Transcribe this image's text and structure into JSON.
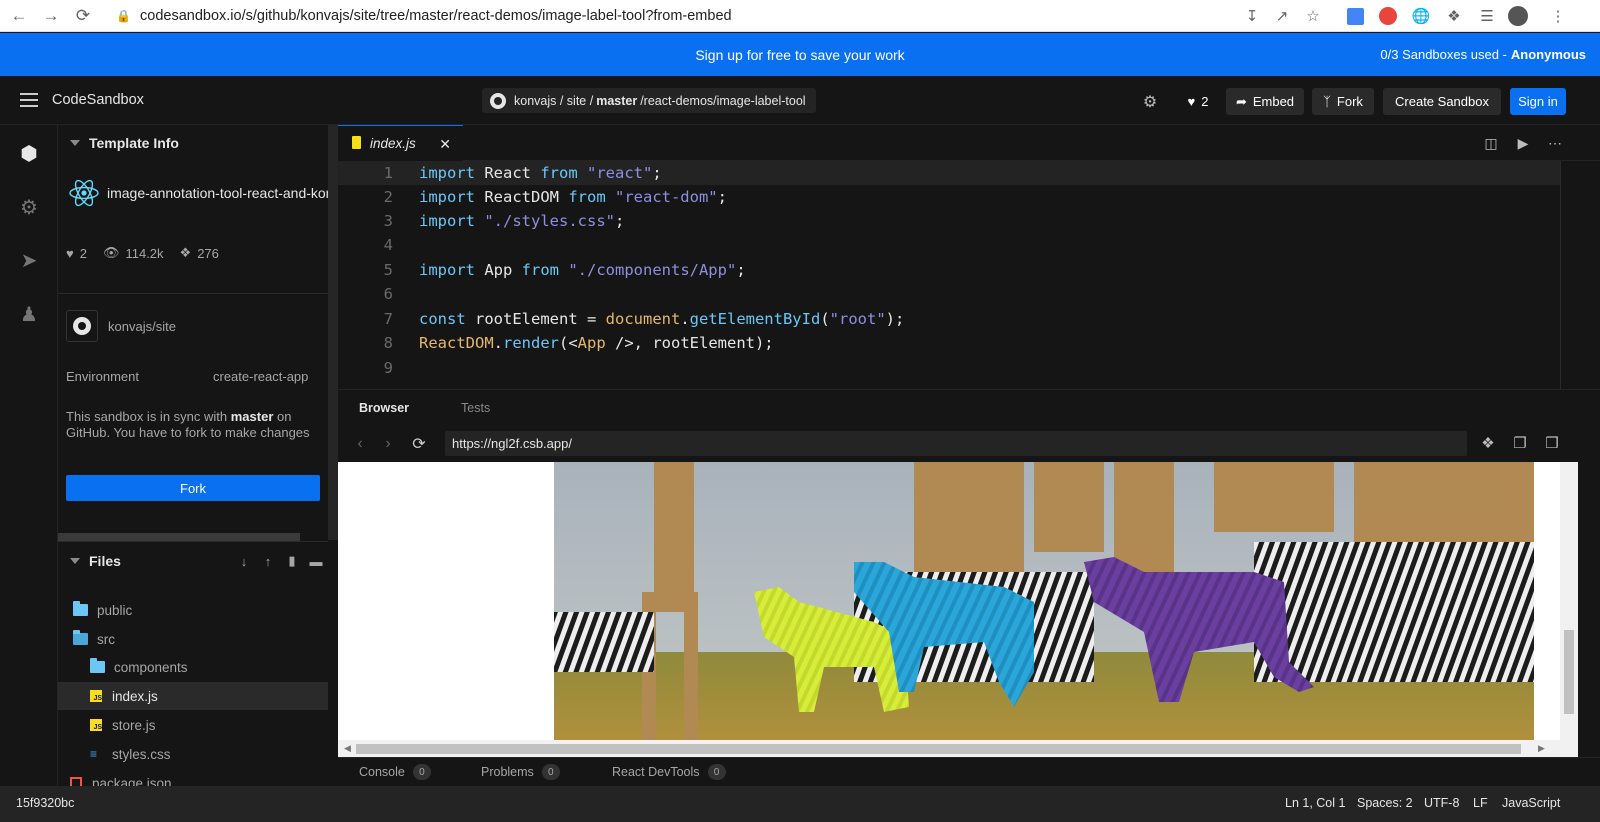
{
  "browser": {
    "url": "codesandbox.io/s/github/konvajs/site/tree/master/react-demos/image-label-tool?from-embed"
  },
  "banner": {
    "message": "Sign up for free to save your work",
    "usage": "0/3 Sandboxes used -",
    "user": "Anonymous"
  },
  "header": {
    "brand": "CodeSandbox",
    "repo_owner": "konvajs / site /",
    "repo_branch": "master",
    "repo_path": "/react-demos/image-label-tool",
    "likes": "2",
    "embed_label": "Embed",
    "fork_label": "Fork",
    "create_label": "Create Sandbox",
    "signin_label": "Sign in"
  },
  "sidebar": {
    "template_info_title": "Template Info",
    "template_name": "image-annotation-tool-react-and-konva",
    "likes": "2",
    "views": "114.2k",
    "forks": "276",
    "github_repo": "konvajs/site",
    "environment_label": "Environment",
    "environment_value": "create-react-app",
    "sync_prefix": "This sandbox is in sync with",
    "sync_branch": "master",
    "sync_suffix": "on GitHub. You have to fork to make changes",
    "fork_button": "Fork",
    "files_title": "Files",
    "files": [
      {
        "name": "public",
        "type": "folder"
      },
      {
        "name": "src",
        "type": "folder"
      },
      {
        "name": "components",
        "type": "folder"
      },
      {
        "name": "index.js",
        "type": "js"
      },
      {
        "name": "store.js",
        "type": "js"
      },
      {
        "name": "styles.css",
        "type": "css"
      },
      {
        "name": "package.json",
        "type": "json"
      }
    ]
  },
  "editor": {
    "tab": "index.js",
    "line_numbers": [
      "1",
      "2",
      "3",
      "4",
      "5",
      "6",
      "7",
      "8",
      "9"
    ],
    "code": {
      "l1": {
        "kw1": "import",
        "id": " React ",
        "kw2": "from",
        "str": " \"react\"",
        "end": ";"
      },
      "l2": {
        "kw1": "import",
        "id": " ReactDOM ",
        "kw2": "from",
        "str": " \"react-dom\"",
        "end": ";"
      },
      "l3": {
        "kw1": "import",
        "str": " \"./styles.css\"",
        "end": ";"
      },
      "l5": {
        "kw1": "import",
        "id": " App ",
        "kw2": "from",
        "str": " \"./components/App\"",
        "end": ";"
      },
      "l7": {
        "kw1": "const",
        "id": " rootElement = ",
        "obj": "document",
        "dot": ".",
        "fn": "getElementById",
        "open": "(",
        "str": "\"root\"",
        "end": ");"
      },
      "l8": {
        "obj": "ReactDOM",
        "dot": ".",
        "fn": "render",
        "open": "(<",
        "comp": "App",
        "mid": " />, rootElement);"
      }
    }
  },
  "preview": {
    "tab_browser": "Browser",
    "tab_tests": "Tests",
    "url": "https://ngl2f.csb.app/"
  },
  "bottom_tabs": [
    {
      "label": "Console",
      "count": "0"
    },
    {
      "label": "Problems",
      "count": "0"
    },
    {
      "label": "React DevTools",
      "count": "0"
    }
  ],
  "status": {
    "hash": "15f9320bc",
    "position": "Ln 1, Col 1",
    "spaces": "Spaces: 2",
    "encoding": "UTF-8",
    "eol": "LF",
    "language": "JavaScript"
  },
  "colors": {
    "accent": "#0971f1",
    "label_yellow": "#d6ee3a",
    "label_blue": "#2aa6d8",
    "label_purple": "#6a3fa0"
  }
}
